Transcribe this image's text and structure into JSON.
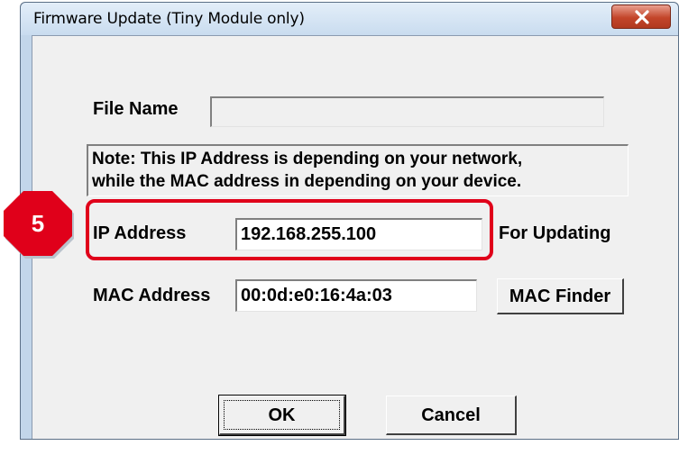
{
  "window": {
    "title": "Firmware Update (Tiny Module only)"
  },
  "file_name": {
    "label": "File Name",
    "value": ""
  },
  "note": {
    "line1": "Note: This IP Address is depending on your network,",
    "line2": "while the  MAC address in depending on your device."
  },
  "ip_address": {
    "label": "IP Address",
    "value": "192.168.255.100",
    "suffix": "For Updating"
  },
  "mac_address": {
    "label": "MAC Address",
    "value": "00:0d:e0:16:4a:03",
    "finder_label": "MAC Finder"
  },
  "buttons": {
    "ok": "OK",
    "cancel": "Cancel"
  },
  "annotation": {
    "step_number": "5",
    "badge_color": "#e0001a",
    "highlight_color": "#e0001a"
  },
  "icons": {
    "close": "close-icon"
  }
}
